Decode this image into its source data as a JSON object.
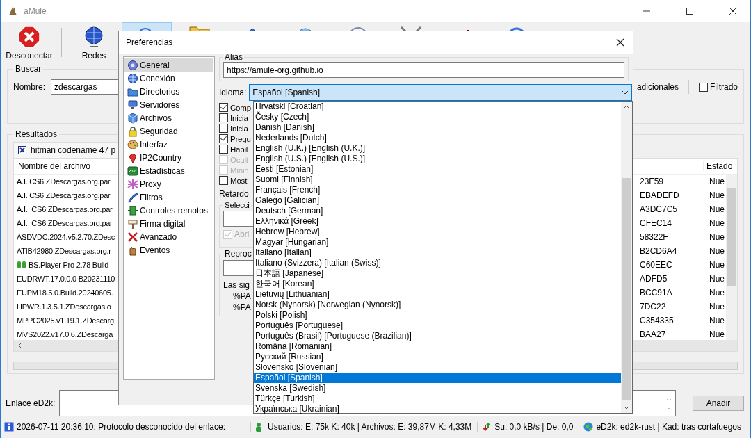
{
  "window": {
    "title": "aMule"
  },
  "toolbar": {
    "buttons": [
      {
        "kind": "disconnect",
        "label": "Desconectar",
        "selected": false
      },
      {
        "kind": "networks",
        "label": "Redes",
        "selected": false
      },
      {
        "kind": "search",
        "selected": true
      },
      {
        "kind": "shared",
        "selected": false
      },
      {
        "kind": "stats",
        "selected": false
      },
      {
        "kind": "messages",
        "selected": false
      },
      {
        "kind": "clock",
        "selected": false
      },
      {
        "kind": "tools",
        "selected": false
      },
      {
        "kind": "import",
        "selected": false
      },
      {
        "kind": "about",
        "selected": false
      }
    ]
  },
  "search": {
    "legend": "Buscar",
    "name_label": "Nombre:",
    "name_value": "zdescargas",
    "extra_label": "adicionales",
    "filter": {
      "label": "Filtrado",
      "checked": false
    }
  },
  "results": {
    "legend": "Resultados",
    "progress": {
      "level": 0
    },
    "tab": {
      "label": "hitman codename 47 p"
    },
    "columns": [
      "Nombre del archivo",
      "Estado"
    ],
    "rows": [
      {
        "kind": "file",
        "name": "A.I. CS6.ZDescargas.org.par",
        "hash": "23F59",
        "status": "Nue"
      },
      {
        "kind": "file",
        "name": "A.I. CS6.ZDescargas.org.par",
        "hash": "EBADEFD",
        "status": "Nue"
      },
      {
        "kind": "file",
        "name": "A.I._CS6.ZDescargas.org.par",
        "hash": "A3DC7C5",
        "status": "Nue"
      },
      {
        "kind": "file",
        "name": "A.I._CS6.ZDescargas.org.par",
        "hash": "CFEC14",
        "status": "Nue"
      },
      {
        "kind": "file",
        "name": "ASDVDC.2024.v5.2.70.ZDesc",
        "hash": "58322F",
        "status": "Nue"
      },
      {
        "kind": "file",
        "name": "ATIB42980.ZDescargas.org.r",
        "hash": "B2CD6A4",
        "status": "Nue"
      },
      {
        "kind": "player",
        "name": "BS.Player Pro 2.78 Build",
        "hash": "C60EEC",
        "status": "Nue"
      },
      {
        "kind": "file",
        "name": "EUDRWT.17.0.0.0 B20231110",
        "hash": "ADFD5",
        "status": "Nue"
      },
      {
        "kind": "file",
        "name": "EUPM18.5.0.Build.20240605.",
        "hash": "BCC91A",
        "status": "Nue"
      },
      {
        "kind": "file",
        "name": "HPWR.1.3.5.1.ZDescargas.o",
        "hash": "7DC22",
        "status": "Nue"
      },
      {
        "kind": "file",
        "name": "MPPC2025.v1.19.1.ZDescarg",
        "hash": "C354335",
        "status": "Nue"
      },
      {
        "kind": "file",
        "name": "MVS2022.v17.0.6.ZDescarga",
        "hash": "BAA27",
        "status": "Nue"
      }
    ]
  },
  "link": {
    "label": "Enlace eD2k:",
    "button": "Añadir"
  },
  "status_bar": {
    "message": "2026-07-11 20:36:10: Protocolo desconocido del enlace:",
    "users": "Usuarios: E: 75k K: 40k | Archivos: E: 39,87M K: 4,33M",
    "speed": "Su: 0,0 kB/s | De: 0,0",
    "network": "eD2k: ed2k-rust | Kad: tras cortafuegos"
  },
  "dialog": {
    "title": "Preferencias",
    "categories": [
      {
        "kind": "general",
        "label": "General",
        "selected": true
      },
      {
        "kind": "connection",
        "label": "Conexión",
        "selected": false
      },
      {
        "kind": "directories",
        "label": "Directorios",
        "selected": false
      },
      {
        "kind": "servers",
        "label": "Servidores",
        "selected": false
      },
      {
        "kind": "files",
        "label": "Archivos",
        "selected": false
      },
      {
        "kind": "security",
        "label": "Seguridad",
        "selected": false
      },
      {
        "kind": "interface",
        "label": "Interfaz",
        "selected": false
      },
      {
        "kind": "ip2country",
        "label": "IP2Country",
        "selected": false
      },
      {
        "kind": "statistics",
        "label": "Estadísticas",
        "selected": false
      },
      {
        "kind": "proxy",
        "label": "Proxy",
        "selected": false
      },
      {
        "kind": "filters",
        "label": "Filtros",
        "selected": false
      },
      {
        "kind": "remote",
        "label": "Controles remotos",
        "selected": false
      },
      {
        "kind": "signature",
        "label": "Firma digital",
        "selected": false
      },
      {
        "kind": "advanced",
        "label": "Avanzado",
        "selected": false
      },
      {
        "kind": "events",
        "label": "Eventos",
        "selected": false
      }
    ],
    "alias": {
      "legend": "Alias",
      "value": "https://amule-org.github.io"
    },
    "language": {
      "label": "Idioma:",
      "value": "Español [Spanish]",
      "expanded": true,
      "options": [
        {
          "label": "Hrvatski [Croatian]",
          "selected": false
        },
        {
          "label": "Česky [Czech]",
          "selected": false
        },
        {
          "label": "Danish [Danish]",
          "selected": false
        },
        {
          "label": "Nederlands [Dutch]",
          "selected": false
        },
        {
          "label": "English (U.K.) [English (U.K.)]",
          "selected": false
        },
        {
          "label": "English (U.S.) [English (U.S.)]",
          "selected": false
        },
        {
          "label": "Eesti [Estonian]",
          "selected": false
        },
        {
          "label": "Suomi [Finnish]",
          "selected": false
        },
        {
          "label": "Français [French]",
          "selected": false
        },
        {
          "label": "Galego [Galician]",
          "selected": false
        },
        {
          "label": "Deutsch [German]",
          "selected": false
        },
        {
          "label": "Ελληνικά [Greek]",
          "selected": false
        },
        {
          "label": "Hebrew [Hebrew]",
          "selected": false
        },
        {
          "label": "Magyar [Hungarian]",
          "selected": false
        },
        {
          "label": "Italiano [Italian]",
          "selected": false
        },
        {
          "label": "Italiano (Svizzera) [Italian (Swiss)]",
          "selected": false
        },
        {
          "label": "日本語 [Japanese]",
          "selected": false
        },
        {
          "label": "한국어 [Korean]",
          "selected": false
        },
        {
          "label": "Lietuvių [Lithuanian]",
          "selected": false
        },
        {
          "label": "Norsk (Nynorsk) [Norwegian (Nynorsk)]",
          "selected": false
        },
        {
          "label": "Polski [Polish]",
          "selected": false
        },
        {
          "label": "Português [Portuguese]",
          "selected": false
        },
        {
          "label": "Português (Brasil) [Portuguese (Brazilian)]",
          "selected": false
        },
        {
          "label": "Română [Romanian]",
          "selected": false
        },
        {
          "label": "Русский [Russian]",
          "selected": false
        },
        {
          "label": "Slovensko [Slovenian]",
          "selected": false
        },
        {
          "label": "Español [Spanish]",
          "selected": true
        },
        {
          "label": "Svenska [Swedish]",
          "selected": false
        },
        {
          "label": "Türkçe [Turkish]",
          "selected": false
        },
        {
          "label": "Українська [Ukrainian]",
          "selected": false
        }
      ]
    },
    "options": [
      {
        "label": "Comp",
        "checked": true,
        "disabled": false
      },
      {
        "label": "Inicia",
        "checked": false,
        "disabled": false
      },
      {
        "label": "Inicia",
        "checked": false,
        "disabled": false
      },
      {
        "label": "Pregu",
        "checked": true,
        "disabled": false
      },
      {
        "label": "Habil",
        "checked": false,
        "disabled": false
      },
      {
        "label": "Ocult",
        "checked": false,
        "disabled": true
      },
      {
        "label": "Minin",
        "checked": false,
        "disabled": true
      },
      {
        "label": "Most",
        "checked": false,
        "disabled": false
      }
    ],
    "delay_label": "Retardo",
    "group_1": {
      "legend": "Selecci",
      "checkbox": {
        "label": "Abri",
        "checked": true,
        "disabled": true
      }
    },
    "group_2": {
      "legend": "Reproc",
      "lines": [
        "Las sig",
        "%PA",
        "%PA"
      ]
    }
  }
}
